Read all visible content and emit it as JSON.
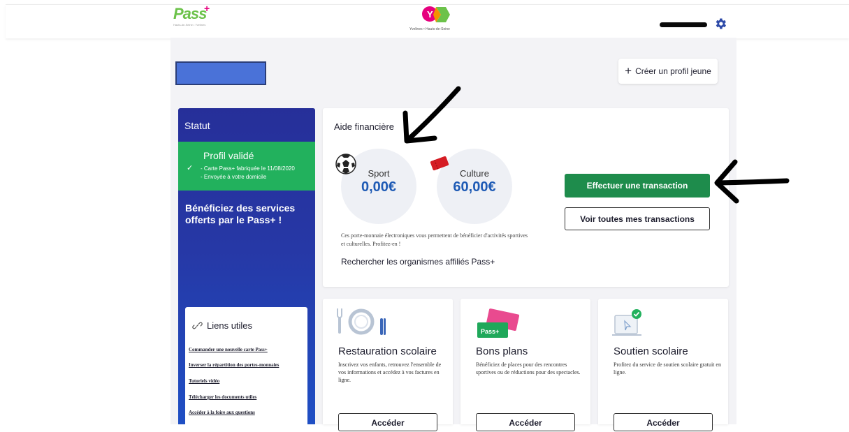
{
  "header": {
    "pass_logo_word": "Pass",
    "pass_logo_plus": "+",
    "pass_logo_tagline": "Hauts-de-Seine • Yvelines",
    "dept_logo_tagline": "Yvelines • Hauts-de-Seine",
    "settings_icon": "gear-icon"
  },
  "actions": {
    "create_profile": "Créer un profil jeune"
  },
  "sidebar": {
    "statut_label": "Statut",
    "profile_status": "Profil validé",
    "status_line1": "- Carte Pass+ fabriquée le 11/08/2020",
    "status_line2": "- Envoyée à votre domicile",
    "benefits_heading": "Bénéficiez des services offerts par le Pass+ !",
    "useful_links": {
      "title": "Liens utiles",
      "items": [
        "Commander une nouvelle carte Pass+",
        "Inverser la répartition des portes-monnaies",
        "Tutoriels vidéo",
        "Télécharger les documents utiles",
        "Accéder à la foire aux questions"
      ]
    }
  },
  "aid": {
    "title": "Aide financière",
    "wallets": [
      {
        "name": "Sport",
        "amount": "0,00€"
      },
      {
        "name": "Culture",
        "amount": "60,00€"
      }
    ],
    "description": "Ces porte-monnaie électroniques vous permettent de bénéficier d'activités sportives et culturelles. Profitez-en !",
    "search_link": "Rechercher les organismes affiliés Pass+",
    "primary_button": "Effectuer une transaction",
    "secondary_button": "Voir toutes mes transactions"
  },
  "services": [
    {
      "title": "Restauration scolaire",
      "text": "Inscrivez vos enfants, retrouvez l'ensemble de vos informations et accédez à vos factures en ligne.",
      "button": "Accéder"
    },
    {
      "title": "Bons plans",
      "text": "Bénéficiez de places pour des rencontres sportives ou de réductions pour des spectacles.",
      "button": "Accéder"
    },
    {
      "title": "Soutien scolaire",
      "text": "Profitez du service de soutien scolaire gratuit en ligne.",
      "button": "Accéder"
    }
  ],
  "colors": {
    "sidebar_blue": "#2638a6",
    "valid_green": "#22b15d",
    "primary_green": "#1e8c4c",
    "amount_blue": "#1f5bb5"
  }
}
